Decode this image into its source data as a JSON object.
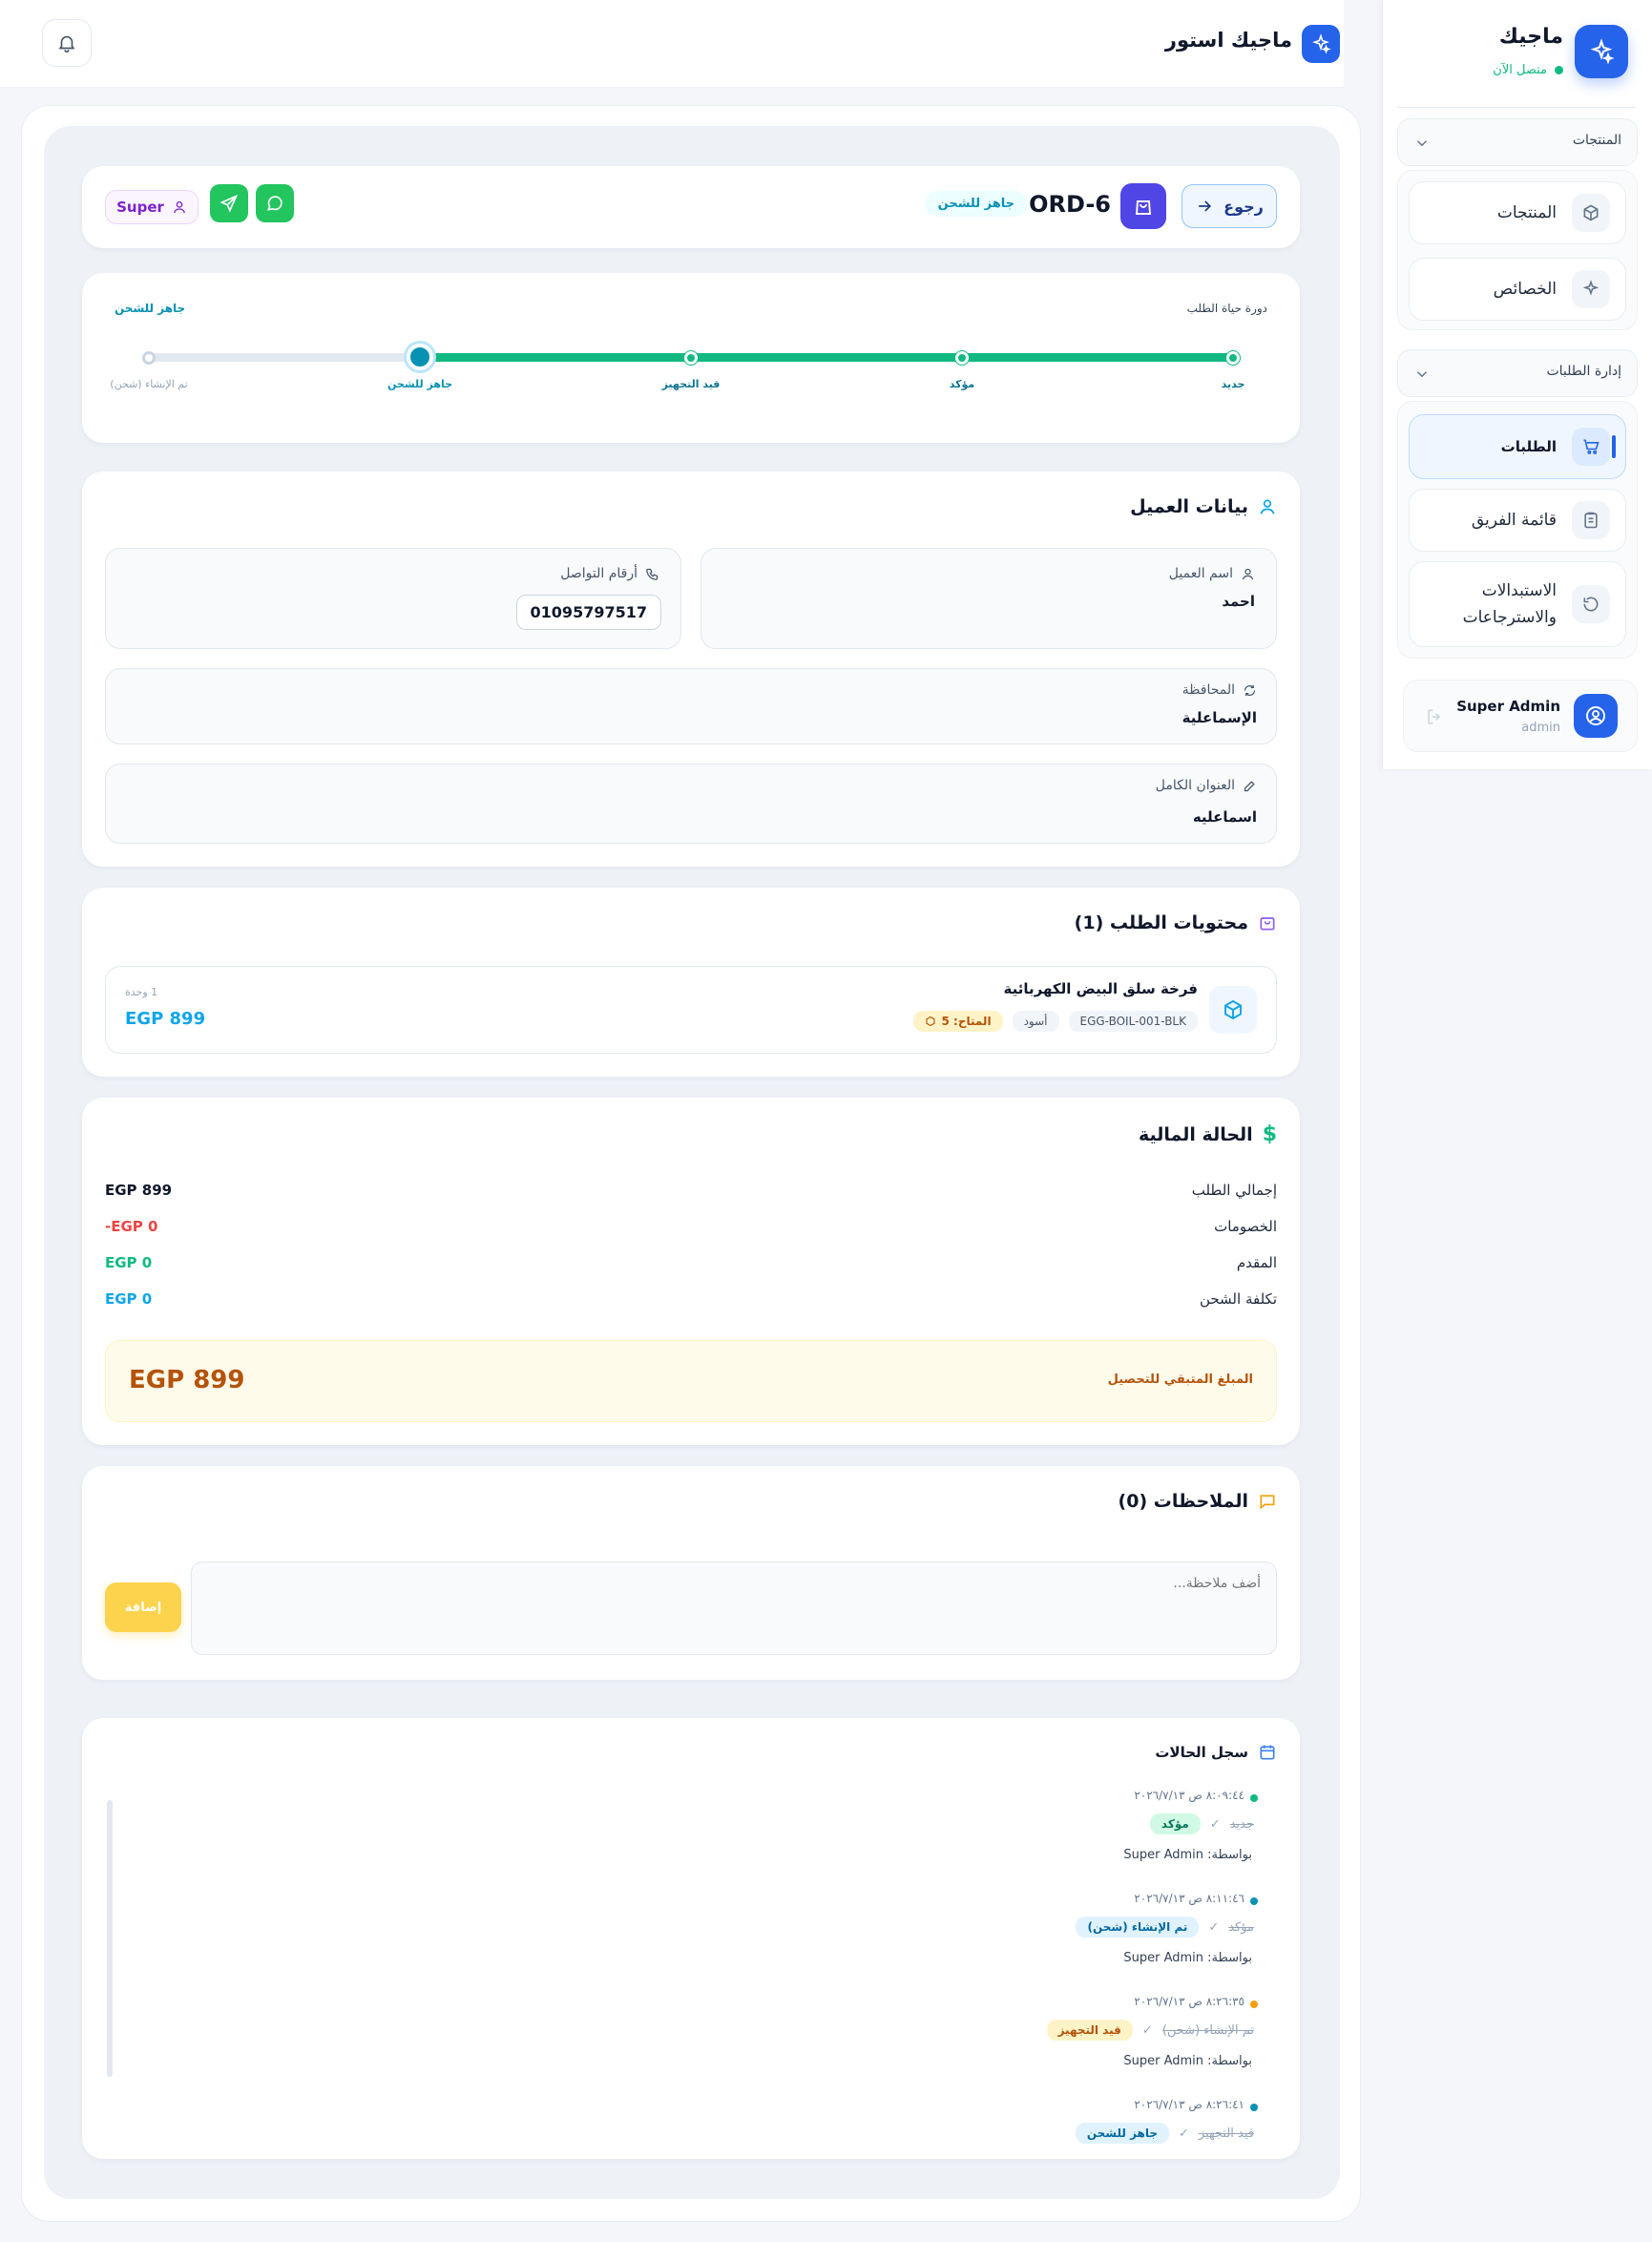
{
  "topbar": {
    "store_name": "ماجيك استور"
  },
  "sidebar": {
    "brand_title": "ماجيك",
    "online_status": "متصل الآن",
    "groups": [
      {
        "label": "المنتجات",
        "items": [
          {
            "label": "المنتجات",
            "icon": "cube-icon"
          },
          {
            "label": "الخصائص",
            "icon": "sparkles-icon"
          }
        ]
      },
      {
        "label": "إدارة الطلبات",
        "items": [
          {
            "label": "الطلبات",
            "icon": "cart-icon",
            "active": true
          },
          {
            "label": "قائمة الفريق",
            "icon": "clipboard-icon"
          },
          {
            "label": "الاستبدالات والاسترجاعات",
            "icon": "refresh-icon"
          }
        ]
      }
    ],
    "user": {
      "name": "Super Admin",
      "role": "admin"
    }
  },
  "order_header": {
    "back_label": "رجوع",
    "order_id": "ORD-6",
    "status": "جاهز للشحن",
    "user_badge": "Super"
  },
  "lifecycle": {
    "title": "دورة حياة الطلب",
    "current": "جاهز للشحن",
    "progress": 0.75,
    "steps": [
      "جديد",
      "مؤكد",
      "قيد التجهيز",
      "جاهز للشحن",
      "تم الإنشاء (شحن)"
    ]
  },
  "customer": {
    "title": "بيانات العميل",
    "name_label": "اسم العميل",
    "name": "احمد",
    "phones_label": "أرقام التواصل",
    "phone": "01095797517",
    "governorate_label": "المحافظة",
    "governorate": "الإسماعلية",
    "address_label": "العنوان الكامل",
    "address": "اسماعليه"
  },
  "contents": {
    "title": "محتويات الطلب (1)",
    "item": {
      "name": "فرخة سلق البيض الكهربائية",
      "sku": "EGG-BOIL-001-BLK",
      "color": "أسود",
      "stock": "المتاح: 5",
      "qty": "1 وحدة",
      "price": "EGP 899"
    }
  },
  "finance": {
    "title": "الحالة المالية",
    "rows": [
      {
        "label": "إجمالي الطلب",
        "value": "EGP 899",
        "color": "#0f172a"
      },
      {
        "label": "الخصومات",
        "value": "-EGP 0",
        "color": "#ef4444"
      },
      {
        "label": "المقدم",
        "value": "EGP 0",
        "color": "#10b981"
      },
      {
        "label": "تكلفة الشحن",
        "value": "EGP 0",
        "color": "#0ea5e9"
      }
    ],
    "remaining_label": "المبلغ المتبقي للتحصيل",
    "remaining_value": "EGP 899"
  },
  "notes": {
    "title": "الملاحظات (0)",
    "placeholder": "أضف ملاحظة...",
    "add_label": "إضافة"
  },
  "history": {
    "title": "سجل الحالات",
    "by_label": "بواسطة: Super Admin",
    "entries": [
      {
        "time": "٨:٠٩:٤٤ ص ٢٠٢٦/٧/١٣",
        "from": "جديد",
        "to": "مؤكد"
      },
      {
        "time": "٨:١١:٤٦ ص ٢٠٢٦/٧/١٣",
        "from": "مؤكد",
        "to": "تم الإنشاء (شحن)"
      },
      {
        "time": "٨:٢٦:٣٥ ص ٢٠٢٦/٧/١٣",
        "from": "تم الإنشاء (شحن)",
        "to": "قيد التجهيز"
      },
      {
        "time": "٨:٢٦:٤١ ص ٢٠٢٦/٧/١٣",
        "from": "قيد التجهيز",
        "to": "جاهز للشحن"
      }
    ]
  },
  "colors": {
    "primary": "#2563eb",
    "success": "#10b981",
    "whatsapp": "#22c55e",
    "warning": "#b45309",
    "remaining_bg": "#fffbeb"
  }
}
